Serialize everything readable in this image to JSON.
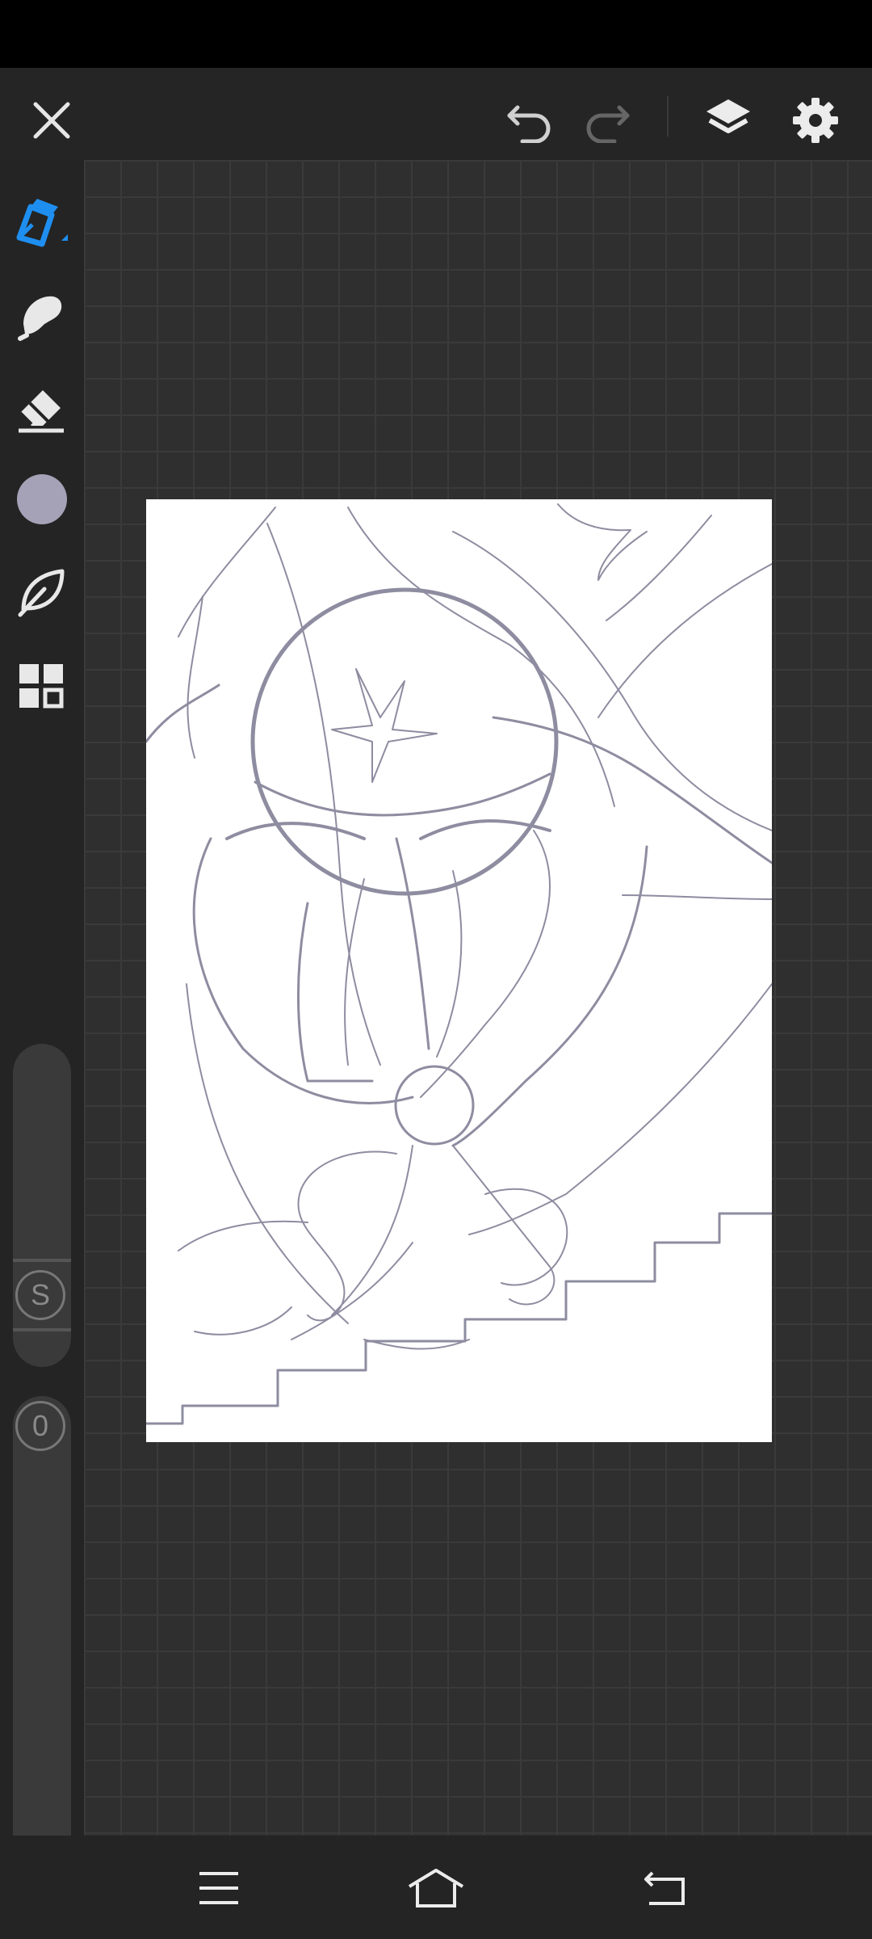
{
  "app": {
    "accent_color": "#1e8ff0",
    "brush_color": "#a5a2b8",
    "sketch_color": "#8e8ca0"
  },
  "top_toolbar": {
    "close_icon": "close-icon",
    "undo_icon": "undo-icon",
    "redo_icon": "redo-icon",
    "layers_icon": "layers-icon",
    "settings_icon": "gear-icon"
  },
  "left_toolbar": {
    "tools": [
      {
        "name": "pen",
        "icon": "pen-icon",
        "active": true
      },
      {
        "name": "smudge",
        "icon": "smudge-icon",
        "active": false
      },
      {
        "name": "eraser",
        "icon": "eraser-icon",
        "active": false
      },
      {
        "name": "color",
        "icon": "color-swatch",
        "active": false
      },
      {
        "name": "brush-library",
        "icon": "leaf-icon",
        "active": false
      },
      {
        "name": "more",
        "icon": "grid-icon",
        "active": false
      }
    ],
    "size_slider_label": "S",
    "opacity_slider_label": "0"
  },
  "nav_bar": {
    "menu_icon": "menu-icon",
    "home_icon": "home-icon",
    "back_icon": "back-icon"
  }
}
